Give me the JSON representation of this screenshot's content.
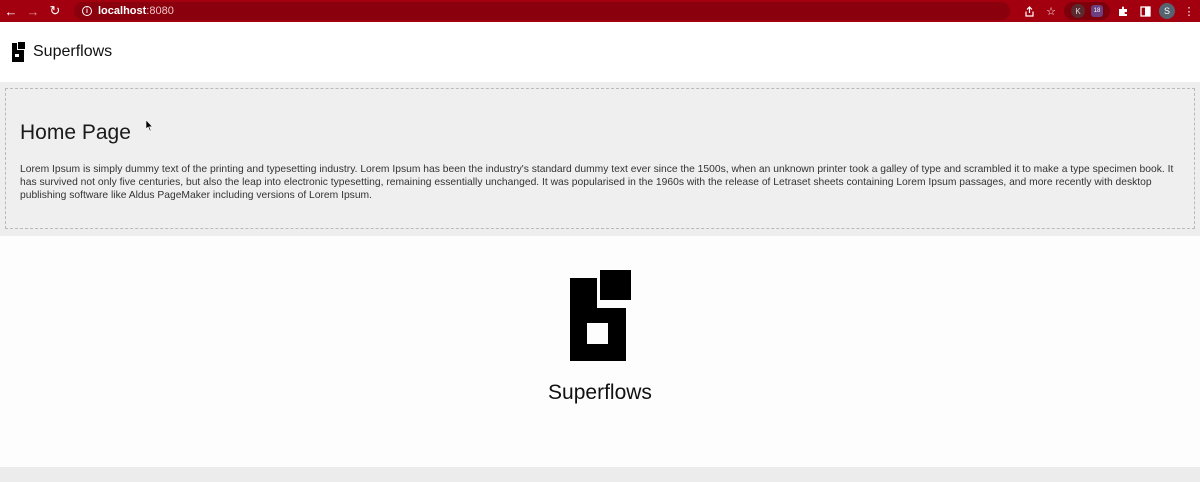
{
  "browser": {
    "url_host": "localhost",
    "url_port": ":8080",
    "profile_initial": "S",
    "extension_k_label": "K",
    "extension_2_label": "18"
  },
  "header": {
    "brand_name": "Superflows"
  },
  "hero": {
    "title": "Home Page",
    "body": "Lorem Ipsum is simply dummy text of the printing and typesetting industry. Lorem Ipsum has been the industry's standard dummy text ever since the 1500s, when an unknown printer took a galley of type and scrambled it to make a type specimen book. It has survived not only five centuries, but also the leap into electronic typesetting, remaining essentially unchanged. It was popularised in the 1960s with the release of Letraset sheets containing Lorem Ipsum passages, and more recently with desktop publishing software like Aldus PageMaker including versions of Lorem Ipsum."
  },
  "main": {
    "brand_name": "Superflows"
  },
  "colors": {
    "chrome": "#a3000f",
    "header_bg": "#ffffff",
    "hero_bg": "#eeeeee",
    "text": "#111111"
  }
}
